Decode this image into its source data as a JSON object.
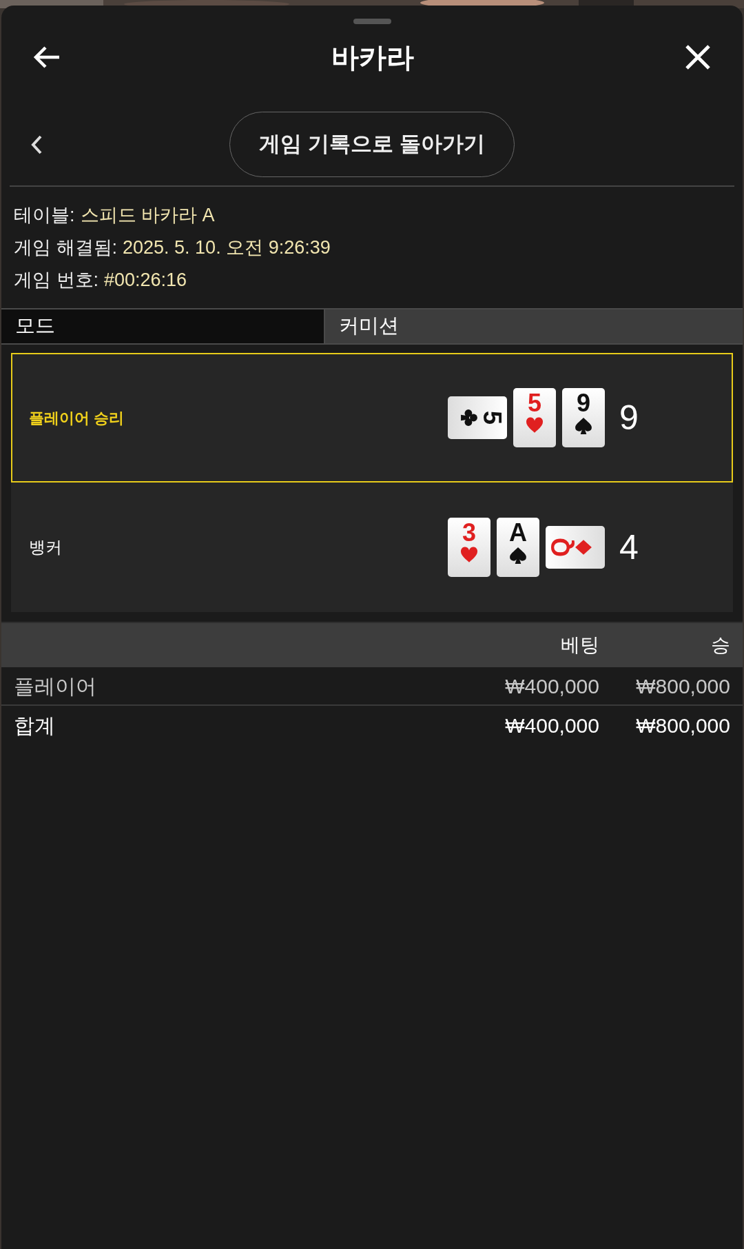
{
  "header": {
    "title": "바카라"
  },
  "back_button": {
    "label": "게임 기록으로 돌아가기"
  },
  "info": [
    {
      "label": "테이블:",
      "value": "스피드 바카라 A"
    },
    {
      "label": "게임 해결됨:",
      "value": "2025. 5. 10. 오전 9:26:39"
    },
    {
      "label": "게임 번호:",
      "value": "#00:26:16"
    }
  ],
  "mode": {
    "label": "모드",
    "value": "커미션"
  },
  "hands": [
    {
      "label": "플레이어 승리",
      "winner": true,
      "score": "9",
      "cards": [
        {
          "rank": "5",
          "kind": "clubs",
          "turned_right": true,
          "turned_left": false
        },
        {
          "rank": "5",
          "kind": "hearts",
          "turned_right": false,
          "turned_left": false
        },
        {
          "rank": "9",
          "kind": "spades",
          "turned_right": false,
          "turned_left": false
        }
      ]
    },
    {
      "label": "뱅커",
      "winner": false,
      "score": "4",
      "cards": [
        {
          "rank": "3",
          "kind": "hearts",
          "turned_right": false,
          "turned_left": false
        },
        {
          "rank": "A",
          "kind": "spades",
          "turned_right": false,
          "turned_left": false
        },
        {
          "rank": "Q",
          "kind": "diamonds",
          "turned_right": false,
          "turned_left": true
        }
      ]
    }
  ],
  "bets": {
    "columns": [
      "베팅",
      "승"
    ],
    "rows": [
      {
        "kind": "bet",
        "name": "플레이어",
        "bet": "₩400,000",
        "win": "₩800,000"
      },
      {
        "kind": "total",
        "name": "합계",
        "bet": "₩400,000",
        "win": "₩800,000"
      }
    ]
  }
}
